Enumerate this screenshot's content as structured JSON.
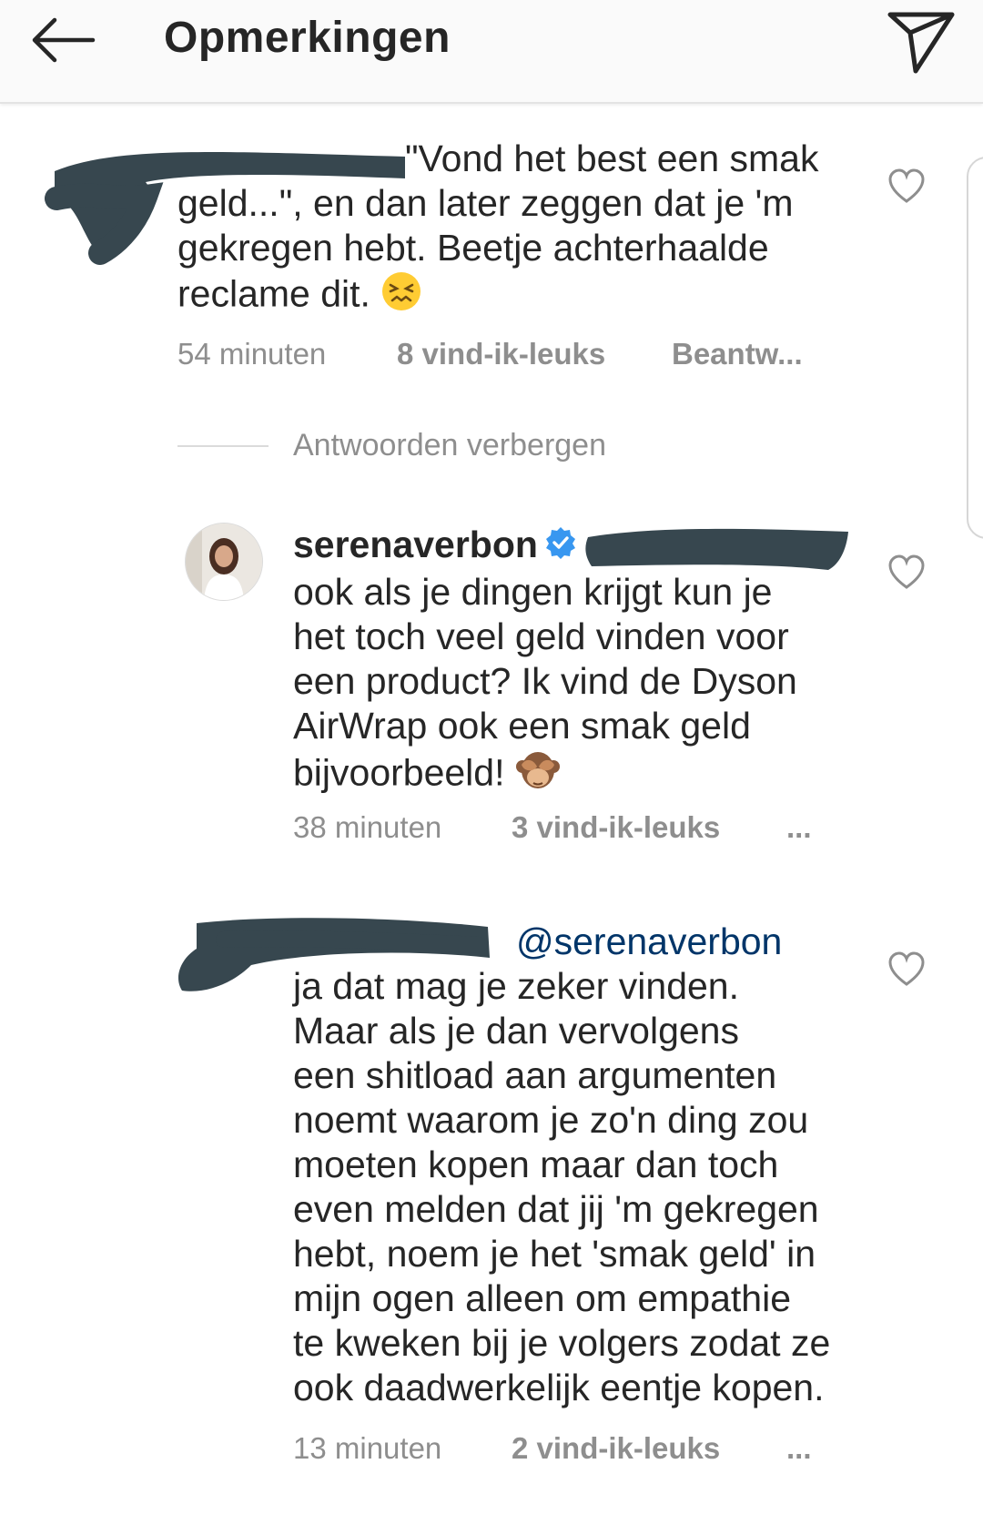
{
  "header": {
    "title": "Opmerkingen",
    "back_icon": "arrow-left-icon",
    "share_icon": "paper-plane-icon"
  },
  "comments": [
    {
      "text_lines": [
        "\"Vond het best een smak",
        "geld...\", en dan later zeggen dat je 'm",
        "gekregen hebt. Beetje achterhaalde",
        "reclame dit."
      ],
      "emoji": "confounded-face",
      "time": "54 minuten",
      "likes": "8 vind-ik-leuks",
      "reply": "Beantw..."
    },
    {
      "username": "serenaverbon",
      "verified": true,
      "text_lines": [
        "ook als je dingen krijgt kun je",
        "het toch veel geld vinden voor",
        "een product? Ik vind de Dyson",
        "AirWrap ook een smak geld",
        "bijvoorbeeld!"
      ],
      "emoji": "see-no-evil-monkey",
      "time": "38 minuten",
      "likes": "3 vind-ik-leuks",
      "more": "..."
    },
    {
      "mention": "@serenaverbon",
      "text_lines": [
        "ja dat mag je zeker vinden.",
        "Maar als je dan vervolgens",
        "een shitload aan argumenten",
        "noemt waarom je zo'n ding zou",
        "moeten kopen maar dan toch",
        "even melden dat jij 'm gekregen",
        "hebt, noem je het 'smak geld' in",
        "mijn ogen alleen om empathie",
        "te kweken bij je volgers zodat ze",
        "ook daadwerkelijk eentje kopen."
      ],
      "time": "13 minuten",
      "likes": "2 vind-ik-leuks",
      "more": "..."
    }
  ],
  "hide_replies": "Antwoorden verbergen",
  "colors": {
    "text": "#262626",
    "muted": "#8e8e8e",
    "mention": "#003569",
    "verified": "#3897f0",
    "redaction": "#37474f"
  }
}
